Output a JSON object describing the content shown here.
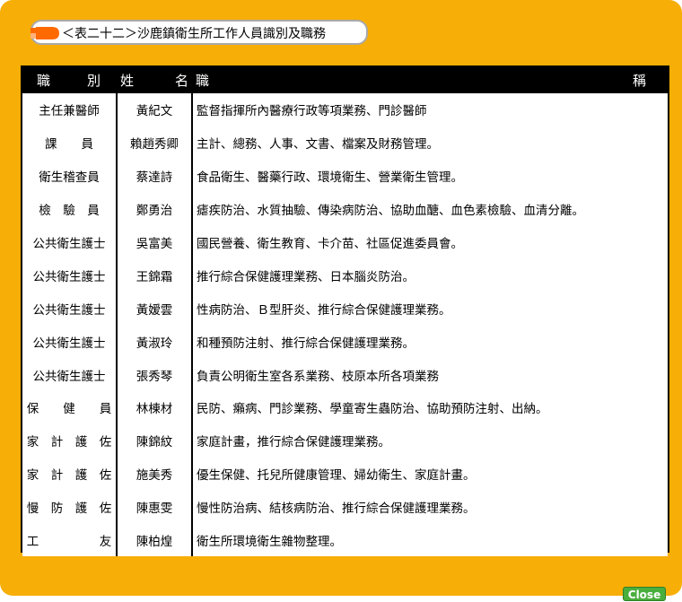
{
  "title": "＜表二十二＞沙鹿鎮衛生所工作人員識別及職務",
  "header": {
    "col1_a": "職",
    "col1_b": "別",
    "col2_a": "姓",
    "col2_b": "名",
    "col3_a": "職",
    "col3_b": "稱"
  },
  "rows": [
    {
      "role": "主任兼醫師",
      "name": "黃紀文",
      "duty": "監督指揮所內醫療行政等項業務、門診醫師"
    },
    {
      "role": "課　　員",
      "name": "賴趙秀卿",
      "duty": "主計、總務、人事、文書、檔案及財務管理。"
    },
    {
      "role": "衛生稽查員",
      "name": "蔡達詩",
      "duty": "食品衛生、醫藥行政、環境衛生、營業衛生管理。"
    },
    {
      "role": "檢　驗　員",
      "name": "鄭勇治",
      "duty": "瘧疾防治、水質抽驗、傳染病防治、協助血醣、血色素檢驗、血清分離。"
    },
    {
      "role": "公共衛生護士",
      "name": "吳富美",
      "duty": "國民營養、衛生教育、卡介苗、社區促進委員會。"
    },
    {
      "role": "公共衛生護士",
      "name": "王錦霜",
      "duty": "推行綜合保健護理業務、日本腦炎防治。"
    },
    {
      "role": "公共衛生護士",
      "name": "黃嫒雲",
      "duty": "性病防治、Ｂ型肝炎、推行綜合保健護理業務。"
    },
    {
      "role": "公共衛生護士",
      "name": "黃淑玲",
      "duty": "和種預防注射、推行綜合保健護理業務。"
    },
    {
      "role": "公共衛生護士",
      "name": "張秀琴",
      "duty": "負責公明衛生室各系業務、枝原本所各項業務"
    },
    {
      "role": "保　　健　　員",
      "name": "林棟材",
      "duty": "民防、癩病、門診業務、學童寄生蟲防治、協助預防注射、出納。"
    },
    {
      "role": "家　計　護　佐",
      "name": "陳錦紋",
      "duty": "家庭計畫，推行綜合保健護理業務。"
    },
    {
      "role": "家　計　護　佐",
      "name": "施美秀",
      "duty": "優生保健、托兒所健康管理、婦幼衛生、家庭計畫。"
    },
    {
      "role": "慢　防　護　佐",
      "name": "陳惠雯",
      "duty": "慢性防治病、結核病防治、推行綜合保健護理業務。"
    },
    {
      "role": "工　　　　　友",
      "name": "陳柏煌",
      "duty": "衛生所環境衛生雜物整理。"
    }
  ],
  "close_label": "Close"
}
